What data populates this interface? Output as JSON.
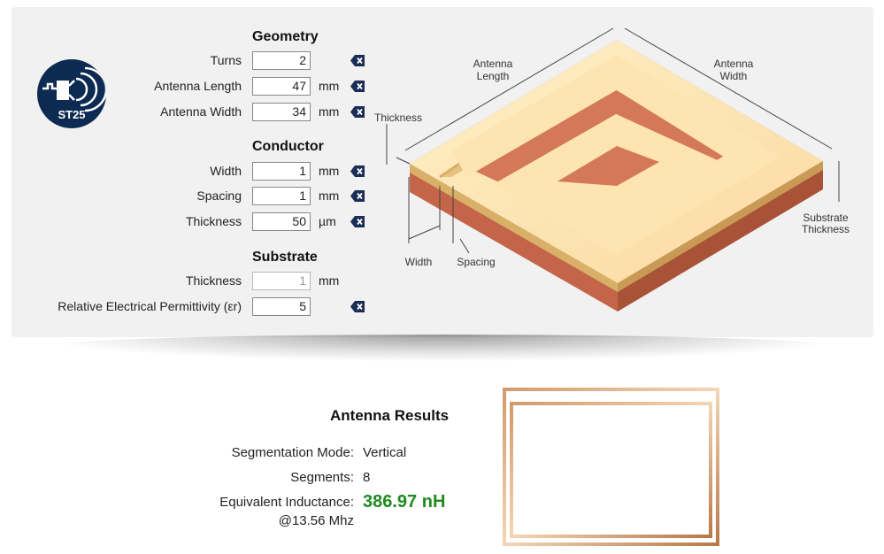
{
  "logo": {
    "text": "ST25"
  },
  "geometry": {
    "title": "Geometry",
    "turns": {
      "label": "Turns",
      "value": "2"
    },
    "antenna_length": {
      "label": "Antenna Length",
      "value": "47",
      "unit": "mm"
    },
    "antenna_width": {
      "label": "Antenna Width",
      "value": "34",
      "unit": "mm"
    }
  },
  "conductor": {
    "title": "Conductor",
    "width": {
      "label": "Width",
      "value": "1",
      "unit": "mm"
    },
    "spacing": {
      "label": "Spacing",
      "value": "1",
      "unit": "mm"
    },
    "thickness": {
      "label": "Thickness",
      "value": "50",
      "unit": "µm"
    }
  },
  "substrate": {
    "title": "Substrate",
    "thickness": {
      "label": "Thickness",
      "value": "1",
      "unit": "mm"
    },
    "permittivity": {
      "label": "Relative Electrical Permittivity (εr)",
      "value": "5"
    }
  },
  "diagram": {
    "antenna_length_1": "Antenna",
    "antenna_length_2": "Length",
    "antenna_width_1": "Antenna",
    "antenna_width_2": "Width",
    "thickness": "Thickness",
    "width": "Width",
    "spacing": "Spacing",
    "substrate_thickness_1": "Substrate",
    "substrate_thickness_2": "Thickness"
  },
  "results": {
    "title": "Antenna Results",
    "segmentation_mode_label": "Segmentation Mode:",
    "segmentation_mode_value": "Vertical",
    "segments_label": "Segments:",
    "segments_value": "8",
    "inductance_label": "Equivalent Inductance:",
    "inductance_freq": "@13.56 Mhz",
    "inductance_value": "386.97 nH"
  },
  "colors": {
    "accent_green": "#1f8a1f",
    "logo_navy": "#0d2a52",
    "copper": "#c96a4a",
    "conductor_top": "#fde4b0"
  },
  "icons": {
    "clear": "clear-x-icon"
  }
}
